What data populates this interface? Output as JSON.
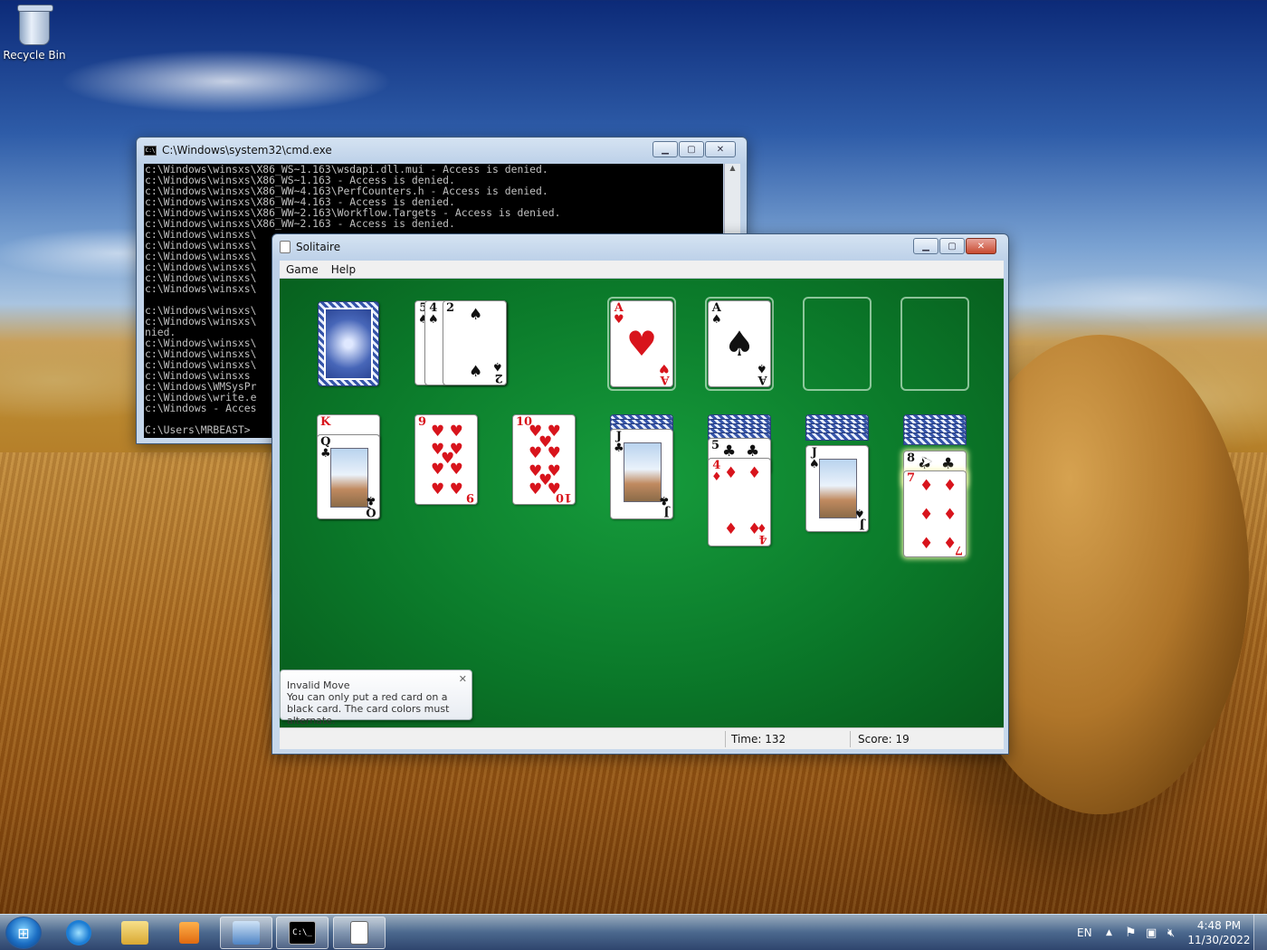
{
  "desktop": {
    "icons": [
      {
        "label": "Recycle Bin",
        "icon": "recycle-bin-icon"
      }
    ]
  },
  "cmd_window": {
    "title": "C:\\Windows\\system32\\cmd.exe",
    "lines": [
      "c:\\Windows\\winsxs\\X86_WS~1.163\\wsdapi.dll.mui - Access is denied.",
      "c:\\Windows\\winsxs\\X86_WS~1.163 - Access is denied.",
      "c:\\Windows\\winsxs\\X86_WW~4.163\\PerfCounters.h - Access is denied.",
      "c:\\Windows\\winsxs\\X86_WW~4.163 - Access is denied.",
      "c:\\Windows\\winsxs\\X86_WW~2.163\\Workflow.Targets - Access is denied.",
      "c:\\Windows\\winsxs\\X86_WW~2.163 - Access is denied.",
      "c:\\Windows\\winsxs\\",
      "c:\\Windows\\winsxs\\",
      "c:\\Windows\\winsxs\\",
      "c:\\Windows\\winsxs\\",
      "c:\\Windows\\winsxs\\",
      "c:\\Windows\\winsxs\\",
      "",
      "c:\\Windows\\winsxs\\",
      "c:\\Windows\\winsxs\\",
      "nied.",
      "c:\\Windows\\winsxs\\",
      "c:\\Windows\\winsxs\\",
      "c:\\Windows\\winsxs\\",
      "c:\\Windows\\winsxs",
      "c:\\Windows\\WMSysPr",
      "c:\\Windows\\write.e",
      "c:\\Windows - Acces",
      "",
      "C:\\Users\\MRBEAST>"
    ]
  },
  "solitaire": {
    "title": "Solitaire",
    "menu": [
      "Game",
      "Help"
    ],
    "waste": [
      {
        "rank": "5",
        "suit": "♠"
      },
      {
        "rank": "4",
        "suit": "♠"
      },
      {
        "rank": "2",
        "suit": "♠"
      }
    ],
    "foundations": [
      {
        "rank": "A",
        "suit": "♥"
      },
      {
        "rank": "A",
        "suit": "♠"
      }
    ],
    "tableau": [
      {
        "top": {
          "rank": "K",
          "suit": "♥"
        },
        "card": {
          "rank": "Q",
          "suit": "♣"
        }
      },
      {
        "card": {
          "rank": "9",
          "suit": "♥"
        }
      },
      {
        "card": {
          "rank": "10",
          "suit": "♥"
        }
      },
      {
        "card": {
          "rank": "J",
          "suit": "♣"
        }
      },
      {
        "top": {
          "rank": "5",
          "suit": "♣"
        },
        "card": {
          "rank": "4",
          "suit": "♦"
        }
      },
      {
        "card": {
          "rank": "J",
          "suit": "♠"
        }
      },
      {
        "top": {
          "rank": "8",
          "suit": "♣"
        },
        "card": {
          "rank": "7",
          "suit": "♦"
        }
      }
    ],
    "notification": {
      "title": "Invalid Move",
      "message": "You can only put a red card on a black card. The card colors must alternate."
    },
    "status": {
      "time": "Time: 132",
      "score": "Score: 19"
    }
  },
  "taskbar": {
    "language": "EN",
    "time": "4:48 PM",
    "date": "11/30/2022",
    "pinned": [
      "start-orb",
      "internet-explorer-icon",
      "file-explorer-icon",
      "media-player-icon",
      "remote-desktop-icon",
      "cmd-icon",
      "solitaire-icon"
    ]
  },
  "colors": {
    "felt": "#0b7a2a",
    "card_red": "#d8141c",
    "card_black": "#111111"
  }
}
